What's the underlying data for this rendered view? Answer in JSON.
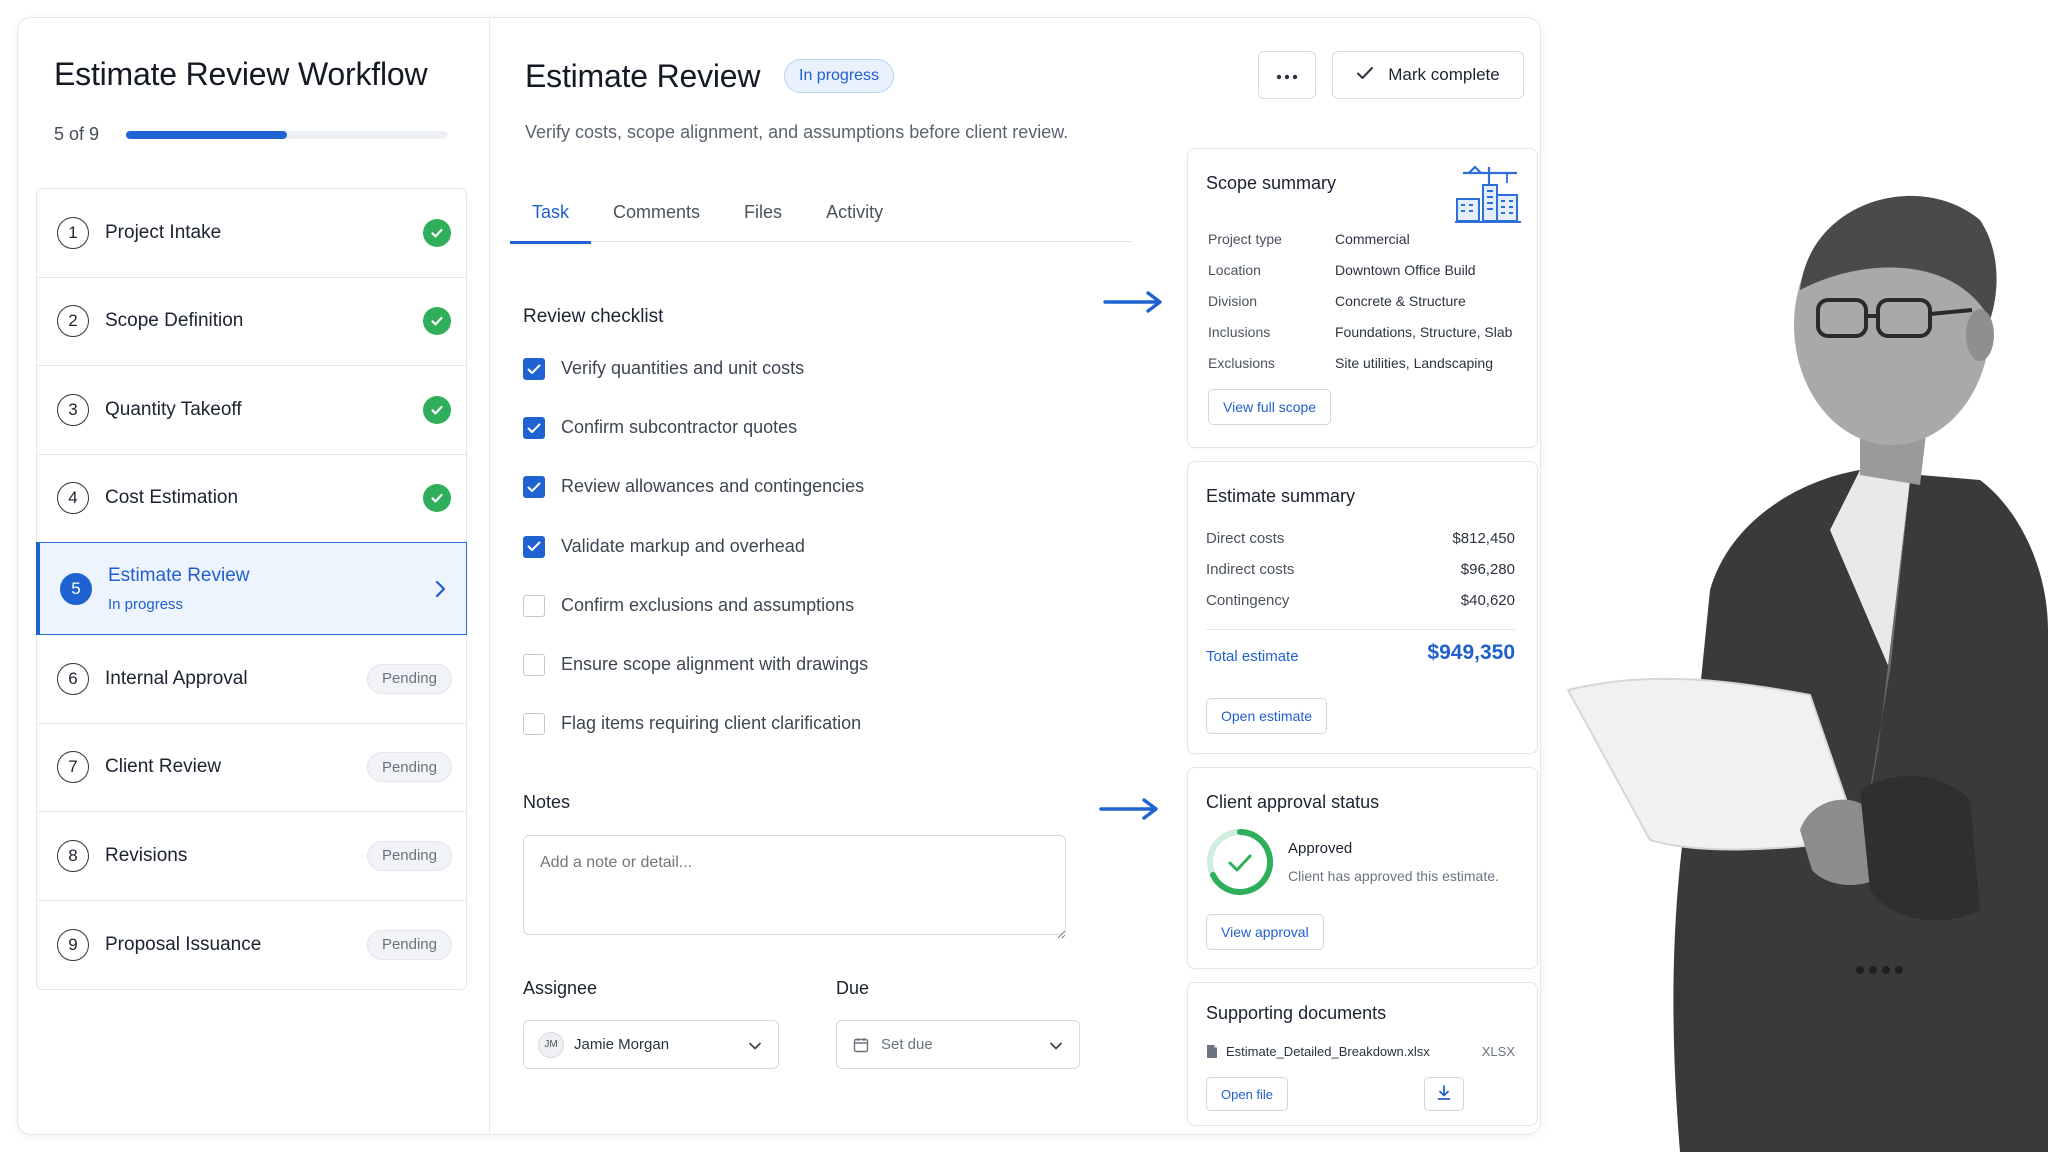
{
  "sidebar": {
    "title": "Estimate Review Workflow",
    "progress_label": "5 of 9",
    "progress_fraction": 0.5,
    "steps": [
      {
        "num": "1",
        "label": "Project Intake",
        "state": "done"
      },
      {
        "num": "2",
        "label": "Scope Definition",
        "state": "done"
      },
      {
        "num": "3",
        "label": "Quantity Takeoff",
        "state": "done"
      },
      {
        "num": "4",
        "label": "Cost Estimation",
        "state": "done"
      },
      {
        "num": "5",
        "label": "Estimate Review",
        "state": "active",
        "sub": "In progress"
      },
      {
        "num": "6",
        "label": "Internal Approval",
        "state": "pending",
        "badge": "Pending"
      },
      {
        "num": "7",
        "label": "Client Review",
        "state": "pending",
        "badge": "Pending"
      },
      {
        "num": "8",
        "label": "Revisions",
        "state": "pending",
        "badge": "Pending"
      },
      {
        "num": "9",
        "label": "Proposal Issuance",
        "state": "pending",
        "badge": "Pending"
      }
    ]
  },
  "header": {
    "title": "Estimate Review",
    "status": "In progress",
    "mark_complete": "Mark complete",
    "subtitle": "Verify costs, scope alignment, and assumptions before client review."
  },
  "tabs": [
    "Task",
    "Comments",
    "Files",
    "Activity"
  ],
  "checklist": {
    "title": "Review checklist",
    "items": [
      {
        "label": "Verify quantities and unit costs",
        "checked": true
      },
      {
        "label": "Confirm subcontractor quotes",
        "checked": true
      },
      {
        "label": "Review allowances and contingencies",
        "checked": true
      },
      {
        "label": "Validate markup and overhead",
        "checked": true
      },
      {
        "label": "Confirm exclusions and assumptions",
        "checked": false
      },
      {
        "label": "Ensure scope alignment with drawings",
        "checked": false
      },
      {
        "label": "Flag items requiring client clarification",
        "checked": false
      }
    ]
  },
  "notes": {
    "title": "Notes",
    "placeholder": "Add a note or detail..."
  },
  "assignee": {
    "label": "Assignee",
    "initials": "JM",
    "name": "Jamie Morgan"
  },
  "due": {
    "label": "Due",
    "placeholder": "Set due"
  },
  "scope_summary": {
    "title": "Scope summary",
    "rows": [
      {
        "k": "Project type",
        "v": "Commercial"
      },
      {
        "k": "Location",
        "v": "Downtown Office Build"
      },
      {
        "k": "Division",
        "v": "Concrete & Structure"
      },
      {
        "k": "Inclusions",
        "v": "Foundations, Structure, Slab"
      },
      {
        "k": "Exclusions",
        "v": "Site utilities, Landscaping"
      }
    ],
    "button": "View full scope"
  },
  "estimate_summary": {
    "title": "Estimate summary",
    "rows": [
      {
        "k": "Direct costs",
        "v": "$812,450"
      },
      {
        "k": "Indirect costs",
        "v": "$96,280"
      },
      {
        "k": "Contingency",
        "v": "$40,620"
      }
    ],
    "total_label": "Total estimate",
    "total_value": "$949,350",
    "button": "Open estimate"
  },
  "client_approval": {
    "title": "Client approval status",
    "status": "Approved",
    "detail": "Client has approved this estimate.",
    "button": "View approval"
  },
  "documents": {
    "title": "Supporting documents",
    "file_name": "Estimate_Detailed_Breakdown.xlsx",
    "file_type": "XLSX",
    "button": "Open file"
  },
  "colors": {
    "accent": "#1f63d3",
    "success": "#2fae5b",
    "pending_bg": "#f1f3f6"
  }
}
